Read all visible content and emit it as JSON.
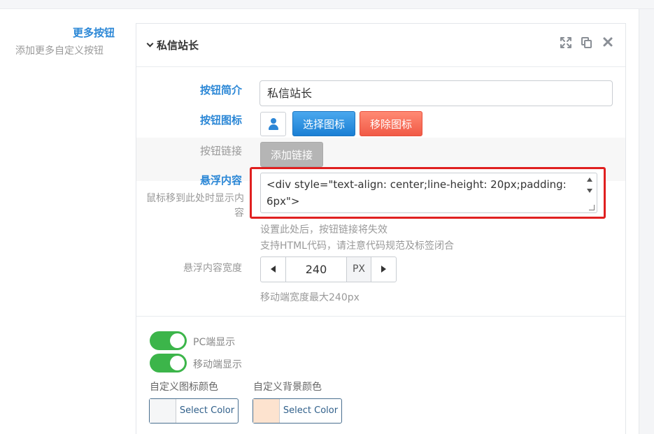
{
  "sidebar": {
    "title": "更多按钮",
    "subtitle": "添加更多自定义按钮"
  },
  "panel": {
    "title": "私信站长",
    "tools": [
      "expand-icon",
      "copy-icon",
      "close-icon"
    ]
  },
  "fields": {
    "intro_label": "按钮简介",
    "intro_value": "私信站长",
    "icon_label": "按钮图标",
    "choose_icon": "选择图标",
    "remove_icon": "移除图标",
    "link_label": "按钮链接",
    "add_link": "添加链接",
    "hover_label": "悬浮内容",
    "hover_hint": "鼠标移到此处时显示内容",
    "hover_value": "<div style=\"text-align: center;line-height: 20px;padding: 6px\">",
    "hover_help1": "设置此处后，按钮链接将失效",
    "hover_help2": "支持HTML代码，请注意代码规范及标签闭合",
    "width_label": "悬浮内容宽度",
    "width_value": "240",
    "width_unit": "PX",
    "width_help": "移动端宽度最大240px"
  },
  "toggles": {
    "pc_label": "PC端显示",
    "mobile_label": "移动端显示",
    "pc_on": true,
    "mobile_on": true
  },
  "colors": {
    "icon_color_label": "自定义图标颜色",
    "bg_color_label": "自定义背景颜色",
    "select_text": "Select Color",
    "icon_color": "#f5f6f7",
    "bg_color": "#fde3cf",
    "accent": "#2b87d6",
    "toggle_green": "#3cb54a",
    "highlight_red": "#e02020"
  }
}
